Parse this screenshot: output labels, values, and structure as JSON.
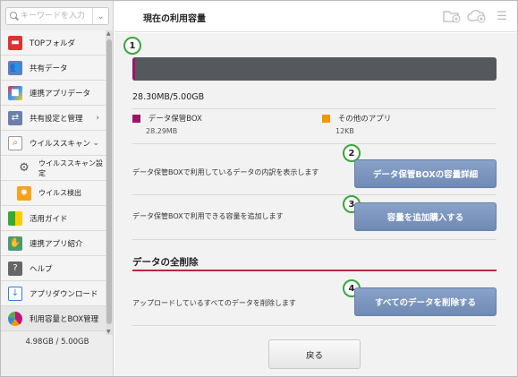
{
  "search": {
    "placeholder": "キーワードを入力"
  },
  "sidebar": {
    "items": [
      {
        "label": "TOPフォルダ",
        "icon": "folder-icon"
      },
      {
        "label": "共有データ",
        "icon": "users-icon"
      },
      {
        "label": "連携アプリデータ",
        "icon": "apps-icon"
      },
      {
        "label": "共有設定と管理",
        "icon": "share-settings-icon",
        "arrow": "›"
      },
      {
        "label": "ウイルススキャン",
        "icon": "virus-scan-icon",
        "arrow": "⌄"
      },
      {
        "label": "ウイルススキャン設定",
        "icon": "gear-icon"
      },
      {
        "label": "ウイルス検出",
        "icon": "virus-icon"
      },
      {
        "label": "活用ガイド",
        "icon": "guide-icon"
      },
      {
        "label": "連携アプリ紹介",
        "icon": "handshake-icon"
      },
      {
        "label": "ヘルプ",
        "icon": "help-icon"
      },
      {
        "label": "アプリダウンロード",
        "icon": "download-icon"
      },
      {
        "label": "利用容量とBOX管理",
        "icon": "storage-icon"
      }
    ],
    "total_usage": "4.98GB / 5.00GB"
  },
  "header": {
    "title": "現在の利用容量"
  },
  "main": {
    "badges": [
      "1",
      "2",
      "3",
      "4"
    ],
    "usage_text": "28.30MB/5.00GB",
    "usage_fraction": 0.00565,
    "legend": [
      {
        "label": "データ保管BOX",
        "value": "28.29MB",
        "color": "#a0136b"
      },
      {
        "label": "その他のアプリ",
        "value": "12KB",
        "color": "#f39800"
      }
    ],
    "detail_desc": "データ保管BOXで利用しているデータの内訳を表示します",
    "detail_button": "データ保管BOXの容量詳細",
    "add_desc": "データ保管BOXで利用できる容量を追加します",
    "add_button": "容量を追加購入する",
    "delete_section_title": "データの全削除",
    "delete_desc": "アップロードしているすべてのデータを削除します",
    "delete_button": "すべてのデータを削除する",
    "back_button": "戻る"
  }
}
